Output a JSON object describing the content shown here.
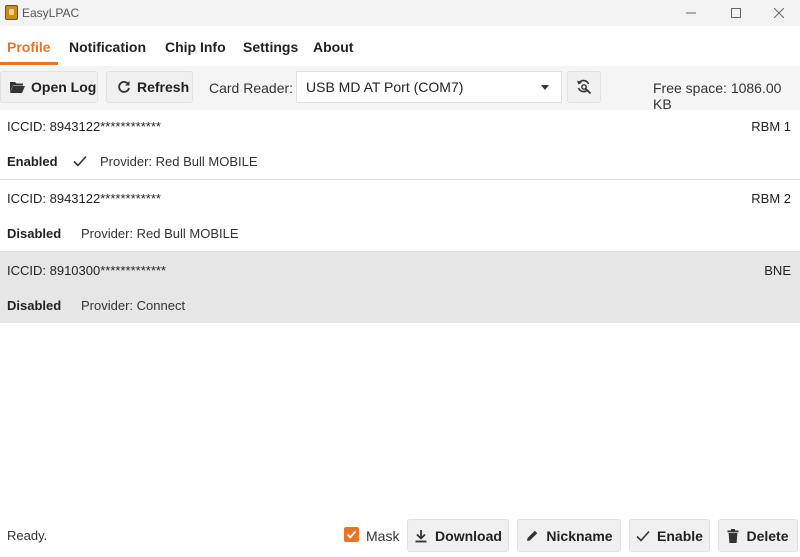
{
  "window": {
    "title": "EasyLPAC",
    "icon": "sim-card-icon"
  },
  "tabs": [
    {
      "label": "Profile",
      "active": true
    },
    {
      "label": "Notification"
    },
    {
      "label": "Chip Info"
    },
    {
      "label": "Settings"
    },
    {
      "label": "About"
    }
  ],
  "toolbar": {
    "open_log": "Open Log",
    "refresh": "Refresh",
    "card_reader_label": "Card Reader:",
    "card_reader_value": "USB MD AT Port (COM7)",
    "free_space": "Free space: 1086.00 KB"
  },
  "profiles": [
    {
      "iccid": "ICCID: 8943122************",
      "nickname": "RBM 1",
      "state": "Enabled",
      "provider": "Provider: Red Bull MOBILE",
      "selected": false
    },
    {
      "iccid": "ICCID: 8943122************",
      "nickname": "RBM 2",
      "state": "Disabled",
      "provider": "Provider: Red Bull MOBILE",
      "selected": false
    },
    {
      "iccid": "ICCID: 8910300*************",
      "nickname": "BNE",
      "state": "Disabled",
      "provider": "Provider: Connect",
      "selected": true
    }
  ],
  "footer": {
    "status": "Ready.",
    "mask_label": "Mask",
    "mask_checked": true,
    "download": "Download",
    "nickname": "Nickname",
    "enable": "Enable",
    "delete": "Delete"
  },
  "colors": {
    "accent": "#e8742b",
    "selected_row": "#e6e6e6",
    "toolbar_bg": "#f5f5f5"
  }
}
